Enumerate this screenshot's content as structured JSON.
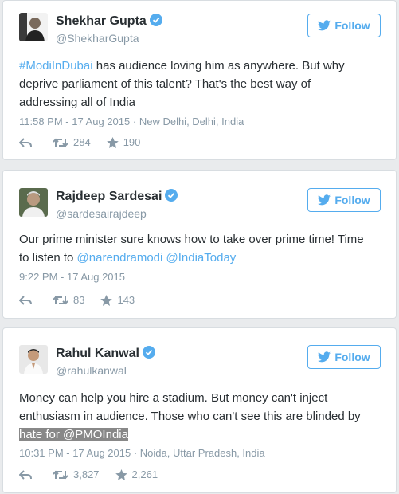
{
  "tweets": [
    {
      "name": "Shekhar Gupta",
      "handle": "@ShekharGupta",
      "follow_label": "Follow",
      "text": {
        "hashtag": "#ModiInDubai",
        "line1_rest": " has audience loving him as anywhere. But why",
        "line2": "deprive parliament of this talent? That's the best way of",
        "line3": "addressing all of India"
      },
      "timestamp": "11:58 PM - 17 Aug 2015",
      "location": "New Delhi, Delhi, India",
      "retweets": "284",
      "favorites": "190"
    },
    {
      "name": "Rajdeep Sardesai",
      "handle": "@sardesairajdeep",
      "follow_label": "Follow",
      "text": {
        "line1": "Our prime minister sure knows how to take over prime time! Time",
        "line2_pre": "to listen to ",
        "mention1": "@narendramodi",
        "space": " ",
        "mention2": "@IndiaToday"
      },
      "timestamp": "9:22 PM - 17 Aug 2015",
      "location": "",
      "retweets": "83",
      "favorites": "143"
    },
    {
      "name": "Rahul Kanwal",
      "handle": "@rahulkanwal",
      "follow_label": "Follow",
      "text": {
        "line1": "Money can help you hire a stadium. But money can't inject",
        "line2": "enthusiasm in audience. Those who can't see this are blinded by",
        "line3_highlight": "hate for @PMOIndia"
      },
      "timestamp": "10:31 PM - 17 Aug 2015",
      "location": "Noida, Uttar Pradesh, India",
      "retweets": "3,827",
      "favorites": "2,261"
    }
  ],
  "colors": {
    "accent": "#55acee",
    "muted": "#8899a6",
    "text": "#292f33"
  }
}
